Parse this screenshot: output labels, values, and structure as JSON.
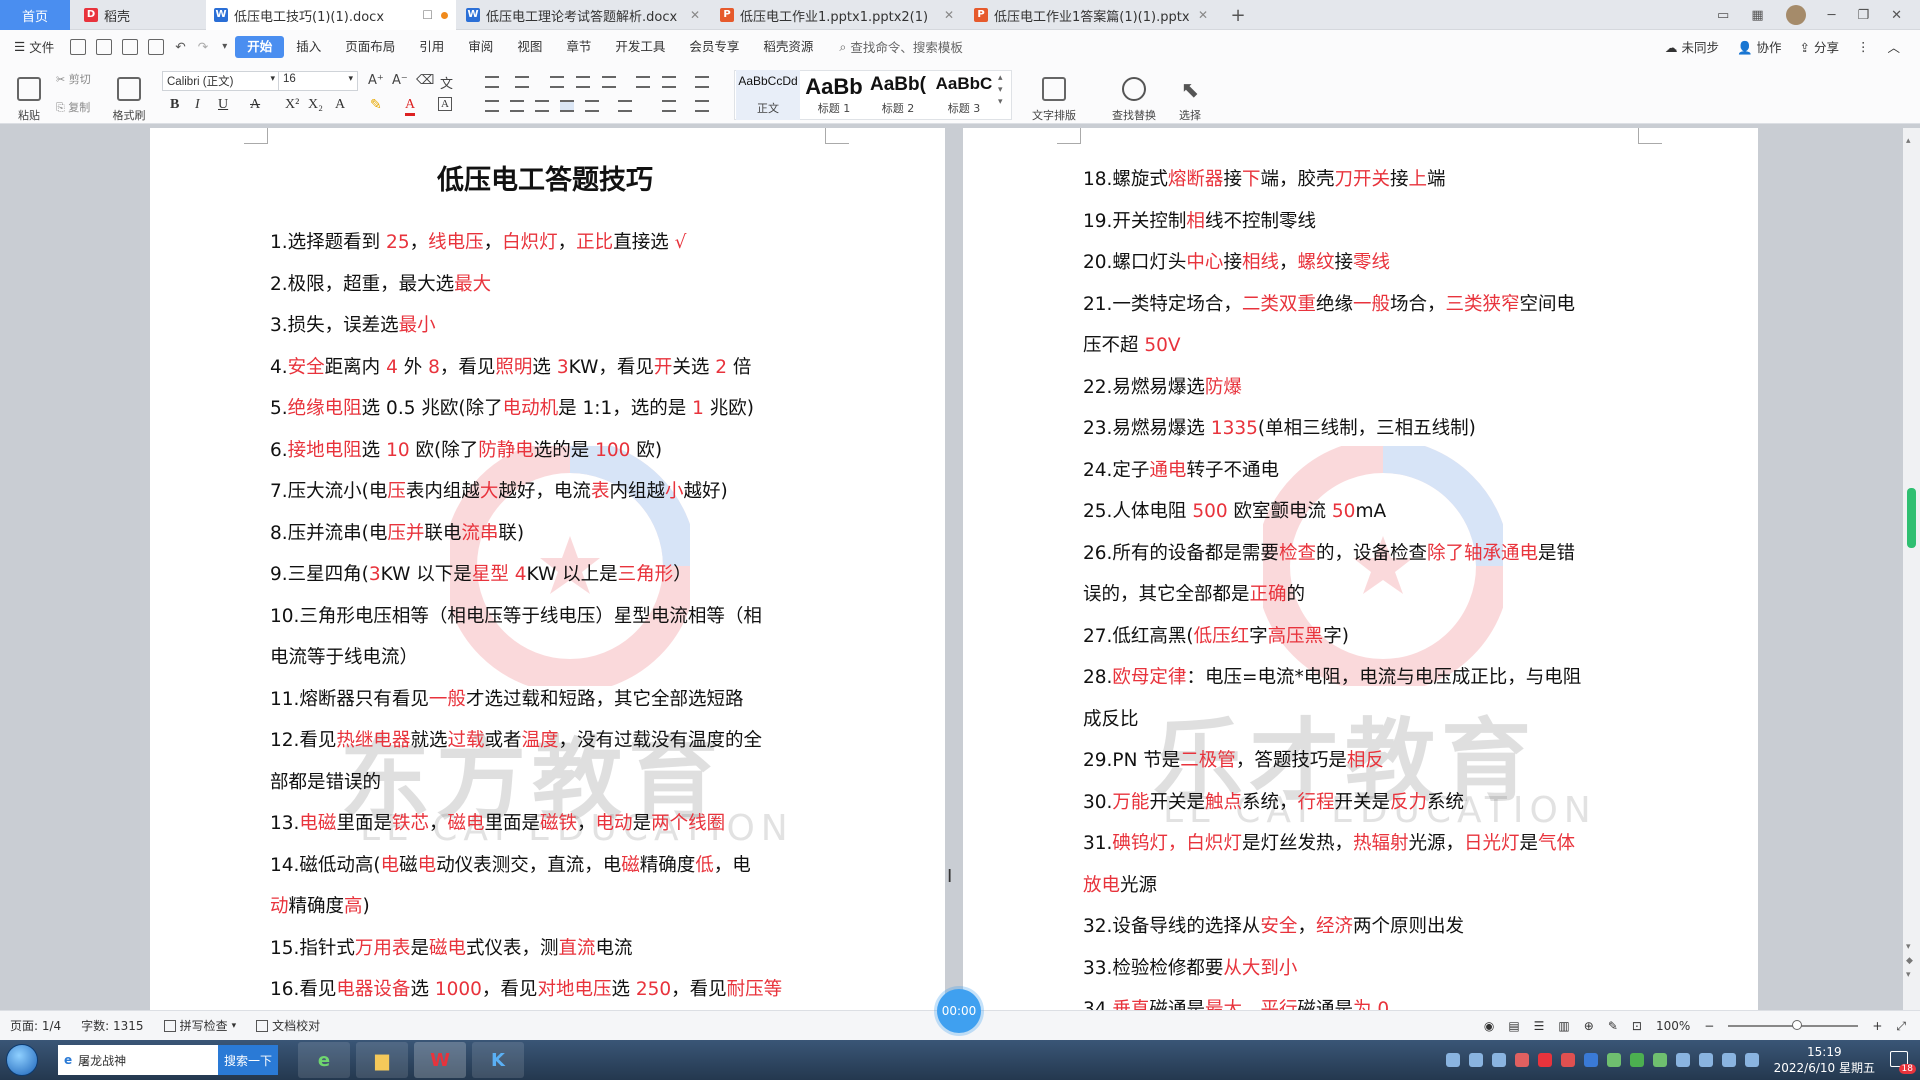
{
  "tabs": [
    {
      "label": "首页",
      "type": "home"
    },
    {
      "label": "稻壳",
      "icon": "docer-icon",
      "icon_color": "#e8333c"
    },
    {
      "label": "低压电工技巧(1)(1).docx",
      "icon": "word-icon",
      "icon_color": "#2b6fd6",
      "active": true,
      "modified": true
    },
    {
      "label": "低压电工理论考试答题解析.docx",
      "icon": "word-icon",
      "icon_color": "#2b6fd6"
    },
    {
      "label": "低压电工作业1.pptx1.pptx2(1)",
      "icon": "ppt-icon",
      "icon_color": "#e65a2c"
    },
    {
      "label": "低压电工作业1答案篇(1)(1).pptx",
      "icon": "ppt-icon",
      "icon_color": "#e65a2c"
    }
  ],
  "menu": {
    "file": "文件",
    "items": [
      "开始",
      "插入",
      "页面布局",
      "引用",
      "审阅",
      "视图",
      "章节",
      "开发工具",
      "会员专享",
      "稻壳资源"
    ],
    "search": "查找命令、搜索模板",
    "right": [
      "未同步",
      "协作",
      "分享"
    ]
  },
  "ribbon": {
    "paste": "粘贴",
    "cut": "剪切",
    "copy": "复制",
    "format_painter": "格式刷",
    "font_name": "Calibri (正文)",
    "font_size": "16",
    "styles": [
      {
        "preview": "AaBbCcDd",
        "label": "正文"
      },
      {
        "preview": "AaBb",
        "label": "标题 1"
      },
      {
        "preview": "AaBb(",
        "label": "标题 2"
      },
      {
        "preview": "AaBbC",
        "label": "标题 3"
      }
    ],
    "text_layout": "文字排版",
    "find_replace": "查找替换",
    "select": "选择"
  },
  "document": {
    "title": "低压电工答题技巧",
    "left_lines": [
      [
        [
          "1.选择题看到 ",
          0
        ],
        [
          "25",
          1
        ],
        [
          "，",
          0
        ],
        [
          "线电压",
          1
        ],
        [
          "，",
          0
        ],
        [
          "白炽灯",
          1
        ],
        [
          "，",
          0
        ],
        [
          "正比",
          1
        ],
        [
          "直接选 ",
          0
        ],
        [
          "√",
          1
        ]
      ],
      [
        [
          "2.极限，超重，最大选",
          0
        ],
        [
          "最大",
          1
        ]
      ],
      [
        [
          "3.损失，误差选",
          0
        ],
        [
          "最小",
          1
        ]
      ],
      [
        [
          "4.",
          0
        ],
        [
          "安全",
          1
        ],
        [
          "距离内 ",
          0
        ],
        [
          "4",
          1
        ],
        [
          " 外 ",
          0
        ],
        [
          "8",
          1
        ],
        [
          "，看见",
          0
        ],
        [
          "照明",
          1
        ],
        [
          "选 ",
          0
        ],
        [
          "3",
          1
        ],
        [
          "KW，看见",
          0
        ],
        [
          "开",
          1
        ],
        [
          "关选 ",
          0
        ],
        [
          "2",
          1
        ],
        [
          " 倍",
          0
        ]
      ],
      [
        [
          "5.",
          0
        ],
        [
          "绝缘电阻",
          1
        ],
        [
          "选 0.5 兆欧(除了",
          0
        ],
        [
          "电动机",
          1
        ],
        [
          "是 1:1，选的是 ",
          0
        ],
        [
          "1",
          1
        ],
        [
          " 兆欧)",
          0
        ]
      ],
      [
        [
          "6.",
          0
        ],
        [
          "接地电阻",
          1
        ],
        [
          "选 ",
          0
        ],
        [
          "10",
          1
        ],
        [
          " 欧(除了",
          0
        ],
        [
          "防静电",
          1
        ],
        [
          "选的是 ",
          0
        ],
        [
          "100",
          1
        ],
        [
          " 欧)",
          0
        ]
      ],
      [
        [
          "7.压大流小(电",
          0
        ],
        [
          "压",
          1
        ],
        [
          "表内组越",
          0
        ],
        [
          "大",
          1
        ],
        [
          "越好，电流",
          0
        ],
        [
          "表",
          1
        ],
        [
          "内组越",
          0
        ],
        [
          "小",
          1
        ],
        [
          "越好)",
          0
        ]
      ],
      [
        [
          "8.压并流串(电",
          0
        ],
        [
          "压并",
          1
        ],
        [
          "联电",
          0
        ],
        [
          "流串",
          1
        ],
        [
          "联)",
          0
        ]
      ],
      [
        [
          "9.三星四角(",
          0
        ],
        [
          "3",
          1
        ],
        [
          "KW 以下是",
          0
        ],
        [
          "星型",
          1
        ],
        [
          " ",
          0
        ],
        [
          "4",
          1
        ],
        [
          "KW 以上是",
          0
        ],
        [
          "三角形",
          1
        ],
        [
          "）",
          0
        ]
      ],
      [
        [
          "10.三角形电压相等（相电压等于线电压）星型电流相等（相",
          0
        ]
      ],
      [
        [
          "电流等于线电流）",
          0
        ]
      ],
      [
        [
          "11.熔断器只有看见",
          0
        ],
        [
          "一般",
          1
        ],
        [
          "才选过载和短路，其它全部选短路",
          0
        ]
      ],
      [
        [
          "12.看见",
          0
        ],
        [
          "热继电器",
          1
        ],
        [
          "就选",
          0
        ],
        [
          "过载",
          1
        ],
        [
          "或者",
          0
        ],
        [
          "温度",
          1
        ],
        [
          "，没有过载没有温度的全",
          0
        ]
      ],
      [
        [
          "部都是错误的",
          0
        ]
      ],
      [
        [
          "13.",
          0
        ],
        [
          "电磁",
          1
        ],
        [
          "里面是",
          0
        ],
        [
          "铁芯",
          1
        ],
        [
          "，",
          0
        ],
        [
          "磁电",
          1
        ],
        [
          "里面是",
          0
        ],
        [
          "磁铁",
          1
        ],
        [
          "，",
          0
        ],
        [
          "电动",
          1
        ],
        [
          "是",
          0
        ],
        [
          "两个线圈",
          1
        ]
      ],
      [
        [
          "14.磁低动高(",
          0
        ],
        [
          "电",
          1
        ],
        [
          "磁",
          0
        ],
        [
          "电",
          1
        ],
        [
          "动仪表测交，直流，电",
          0
        ],
        [
          "磁",
          1
        ],
        [
          "精确度",
          0
        ],
        [
          "低",
          1
        ],
        [
          "，电",
          0
        ]
      ],
      [
        [
          "动",
          1
        ],
        [
          "精确度",
          0
        ],
        [
          "高",
          1
        ],
        [
          ")",
          0
        ]
      ],
      [
        [
          "15.指针式",
          0
        ],
        [
          "万用表",
          1
        ],
        [
          "是",
          0
        ],
        [
          "磁电",
          1
        ],
        [
          "式仪表，测",
          0
        ],
        [
          "直流",
          1
        ],
        [
          "电流",
          0
        ]
      ],
      [
        [
          "16.看见",
          0
        ],
        [
          "电器设备",
          1
        ],
        [
          "选 ",
          0
        ],
        [
          "1000",
          1
        ],
        [
          "，看见",
          0
        ],
        [
          "对地电压",
          1
        ],
        [
          "选 ",
          0
        ],
        [
          "250",
          1
        ],
        [
          "，看见",
          0
        ],
        [
          "耐压等",
          1
        ]
      ]
    ],
    "right_lines": [
      [
        [
          "18.螺旋式",
          0
        ],
        [
          "熔断器",
          1
        ],
        [
          "接",
          0
        ],
        [
          "下",
          1
        ],
        [
          "端，胶壳",
          0
        ],
        [
          "刀开关",
          1
        ],
        [
          "接",
          0
        ],
        [
          "上",
          1
        ],
        [
          "端",
          0
        ]
      ],
      [
        [
          "19.开关控制",
          0
        ],
        [
          "相",
          1
        ],
        [
          "线不控制零线",
          0
        ]
      ],
      [
        [
          "20.螺口灯头",
          0
        ],
        [
          "中心",
          1
        ],
        [
          "接",
          0
        ],
        [
          "相线",
          1
        ],
        [
          "，",
          0
        ],
        [
          "螺纹",
          1
        ],
        [
          "接",
          0
        ],
        [
          "零线",
          1
        ]
      ],
      [
        [
          "21.一类特定场合，",
          0
        ],
        [
          "二类双重",
          1
        ],
        [
          "绝缘",
          0
        ],
        [
          "一般",
          1
        ],
        [
          "场合，",
          0
        ],
        [
          "三类狭窄",
          1
        ],
        [
          "空间电",
          0
        ]
      ],
      [
        [
          "压不超 ",
          0
        ],
        [
          "50V",
          1
        ]
      ],
      [
        [
          "22.易燃易爆选",
          0
        ],
        [
          "防爆",
          1
        ]
      ],
      [
        [
          "23.易燃易爆选 ",
          0
        ],
        [
          "1335",
          1
        ],
        [
          "(单相三线制，三相五线制)",
          0
        ]
      ],
      [
        [
          "24.定子",
          0
        ],
        [
          "通电",
          1
        ],
        [
          "转子不通电",
          0
        ]
      ],
      [
        [
          "25.人体电阻 ",
          0
        ],
        [
          "500",
          1
        ],
        [
          " 欧室颤电流 ",
          0
        ],
        [
          "50",
          1
        ],
        [
          "mA",
          0
        ]
      ],
      [
        [
          "26.所有的设备都是需要",
          0
        ],
        [
          "检查",
          1
        ],
        [
          "的，设备检查",
          0
        ],
        [
          "除了轴承通电",
          1
        ],
        [
          "是错",
          0
        ]
      ],
      [
        [
          "误的，其它全部都是",
          0
        ],
        [
          "正确",
          1
        ],
        [
          "的",
          0
        ]
      ],
      [
        [
          "27.低红高黑(",
          0
        ],
        [
          "低压红",
          1
        ],
        [
          "字",
          0
        ],
        [
          "高压黑",
          1
        ],
        [
          "字)",
          0
        ]
      ],
      [
        [
          "28.",
          0
        ],
        [
          "欧母定律",
          1
        ],
        [
          "：电压=电流*电阻，电流与电压成正比，与电阻",
          0
        ]
      ],
      [
        [
          "成反比",
          0
        ]
      ],
      [
        [
          "29.PN 节是",
          0
        ],
        [
          "二极管",
          1
        ],
        [
          "，答题技巧是",
          0
        ],
        [
          "相反",
          1
        ]
      ],
      [
        [
          "30.",
          0
        ],
        [
          "万能",
          1
        ],
        [
          "开关是",
          0
        ],
        [
          "触点",
          1
        ],
        [
          "系统，",
          0
        ],
        [
          "行程",
          1
        ],
        [
          "开关是",
          0
        ],
        [
          "反力",
          1
        ],
        [
          "系统",
          0
        ]
      ],
      [
        [
          "31.",
          0
        ],
        [
          "碘钨灯，白炽灯",
          1
        ],
        [
          "是灯丝发热，",
          0
        ],
        [
          "热辐射",
          1
        ],
        [
          "光源，",
          0
        ],
        [
          "日光灯",
          1
        ],
        [
          "是",
          0
        ],
        [
          "气体",
          1
        ]
      ],
      [
        [
          "放电",
          1
        ],
        [
          "光源",
          0
        ]
      ],
      [
        [
          "32.设备导线的选择从",
          0
        ],
        [
          "安全",
          1
        ],
        [
          "，",
          0
        ],
        [
          "经济",
          1
        ],
        [
          "两个原则出发",
          0
        ]
      ],
      [
        [
          "33.检验检修都要",
          0
        ],
        [
          "从大到小",
          1
        ]
      ],
      [
        [
          "34.",
          0
        ],
        [
          "垂直",
          1
        ],
        [
          "磁通是",
          0
        ],
        [
          "最大",
          1
        ],
        [
          "，",
          0
        ],
        [
          "平行",
          1
        ],
        [
          "磁通是",
          0
        ],
        [
          "为 0",
          1
        ]
      ]
    ],
    "watermark_text": "东方教育",
    "watermark_text_right": "乐才教育",
    "watermark_sub": "LE CAI EDUCATION"
  },
  "status": {
    "page": "页面: 1/4",
    "words": "字数: 1315",
    "spell": "拼写检查",
    "proof": "文档校对",
    "zoom": "100%",
    "timer": "00:00"
  },
  "taskbar": {
    "browser_title": "屠龙战神",
    "search_button": "搜索一下",
    "time": "15:19",
    "date": "2022/6/10 星期五",
    "notification_count": "18"
  }
}
